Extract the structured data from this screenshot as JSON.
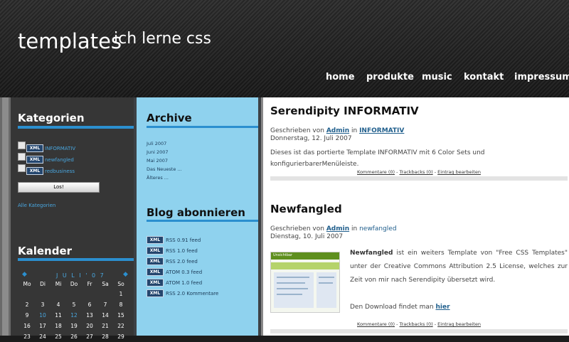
{
  "header": {
    "site_title": "templates",
    "site_subtitle": "ich lerne css",
    "nav": [
      "home",
      "produkte",
      "music",
      "kontakt",
      "impressum"
    ]
  },
  "sidebar": {
    "kategorien_heading": "Kategorien",
    "categories": [
      "INFORMATIV",
      "newfangled",
      "redbusiness"
    ],
    "xml_badge": "XML",
    "submit_label": "Los!",
    "all_categories_link": "Alle Kategorien",
    "kalender_heading": "Kalender",
    "calendar_title": "J U L I  ' 0 7",
    "weekdays": [
      "Mo",
      "Di",
      "Mi",
      "Do",
      "Fr",
      "Sa",
      "So"
    ],
    "weeks": [
      [
        "",
        "",
        "",
        "",
        "",
        "",
        "1"
      ],
      [
        "2",
        "3",
        "4",
        "5",
        "6",
        "7",
        "8"
      ],
      [
        "9",
        "10",
        "11",
        "12",
        "13",
        "14",
        "15"
      ],
      [
        "16",
        "17",
        "18",
        "19",
        "20",
        "21",
        "22"
      ],
      [
        "23",
        "24",
        "25",
        "26",
        "27",
        "28",
        "29"
      ]
    ],
    "highlighted_days": [
      "10",
      "12"
    ]
  },
  "archive": {
    "heading": "Archive",
    "links": [
      "Juli 2007",
      "Juni 2007",
      "Mai 2007",
      "Das Neueste ...",
      "Älteres ..."
    ],
    "subscribe_heading": "Blog abonnieren",
    "feeds": [
      "RSS 0.91 feed",
      "RSS 1.0 feed",
      "RSS 2.0 feed",
      "ATOM 0.3 feed",
      "ATOM 1.0 feed",
      "RSS 2.0 Kommentare"
    ]
  },
  "posts": [
    {
      "title": "Serendipity INFORMATIV",
      "meta_prefix": "Geschrieben von",
      "author": "Admin",
      "meta_in": "in",
      "category": "INFORMATIV",
      "date": "Donnerstag, 12. Juli 2007",
      "body": "Dieses ist das portierte Template INFORMATIV mit 6 Color Sets und konfigurierbarerMenüleiste.",
      "footer": {
        "comments": "Kommentare (0)",
        "trackbacks": "Trackbacks (0)",
        "edit": "Eintrag bearbeiten"
      }
    },
    {
      "title": "Newfangled",
      "meta_prefix": "Geschrieben von",
      "author": "Admin",
      "meta_in": "in",
      "category": "newfangled",
      "date": "Dienstag, 10. Juli 2007",
      "body_bold": "Newfangled",
      "body_rest": " ist ein weiters Template von \"Free CSS Templates\" unter der Creative Commons Attribution 2.5 License, welches zur Zeit von mir nach Serendipity übersetzt wird.",
      "download_text": "Den Download findet man ",
      "download_link": "hier",
      "thumb_title": "Unsichtbar",
      "footer": {
        "comments": "Kommentare (0)",
        "trackbacks": "Trackbacks (0)",
        "edit": "Eintrag bearbeiten"
      }
    }
  ],
  "colors": {
    "accent": "#2b8fcf",
    "archive_bg": "#8fd2ee",
    "link": "#1f5e8c"
  }
}
